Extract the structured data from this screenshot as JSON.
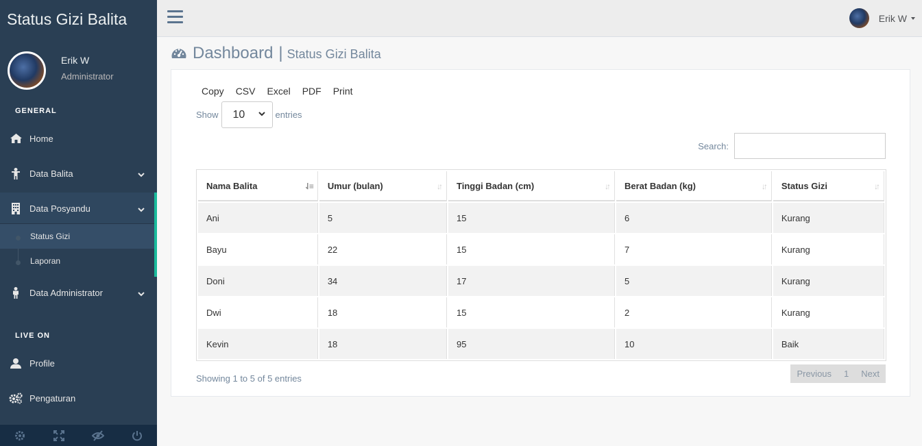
{
  "app": {
    "title": "Status Gizi Balita"
  },
  "profile": {
    "name": "Erik W",
    "role": "Administrator"
  },
  "sidebar": {
    "section_general": "GENERAL",
    "section_live": "LIVE ON",
    "items": [
      {
        "label": "Home",
        "icon": "home-icon"
      },
      {
        "label": "Data Balita",
        "icon": "child-icon"
      },
      {
        "label": "Data Posyandu",
        "icon": "building-icon"
      },
      {
        "label": "Data Administrator",
        "icon": "user-standing-icon"
      },
      {
        "label": "Profile",
        "icon": "user-icon"
      },
      {
        "label": "Pengaturan",
        "icon": "cogs-icon"
      }
    ],
    "children": [
      {
        "label": "Status Gizi"
      },
      {
        "label": "Laporan"
      }
    ],
    "footer_icons": [
      "gear-icon",
      "fullscreen-icon",
      "eye-slash-icon",
      "power-icon"
    ]
  },
  "topnav": {
    "user": "Erik W"
  },
  "page": {
    "title": "Dashboard",
    "subtitle": "Status Gizi Balita"
  },
  "table_tools": {
    "buttons": [
      "Copy",
      "CSV",
      "Excel",
      "PDF",
      "Print"
    ],
    "show_label": "Show",
    "entries_label": "entries",
    "entries_value": "10",
    "search_label": "Search:",
    "search_value": ""
  },
  "table": {
    "headers": [
      "Nama Balita",
      "Umur (bulan)",
      "Tinggi Badan (cm)",
      "Berat Badan (kg)",
      "Status Gizi"
    ],
    "rows": [
      [
        "Ani",
        "5",
        "15",
        "6",
        "Kurang"
      ],
      [
        "Bayu",
        "22",
        "15",
        "7",
        "Kurang"
      ],
      [
        "Doni",
        "34",
        "17",
        "5",
        "Kurang"
      ],
      [
        "Dwi",
        "18",
        "15",
        "2",
        "Kurang"
      ],
      [
        "Kevin",
        "18",
        "95",
        "10",
        "Baik"
      ]
    ]
  },
  "footer": {
    "info": "Showing 1 to 5 of 5 entries",
    "prev": "Previous",
    "page": "1",
    "next": "Next"
  },
  "colors": {
    "sidebar": "#2A3F54",
    "accent": "#1ABB9C"
  }
}
